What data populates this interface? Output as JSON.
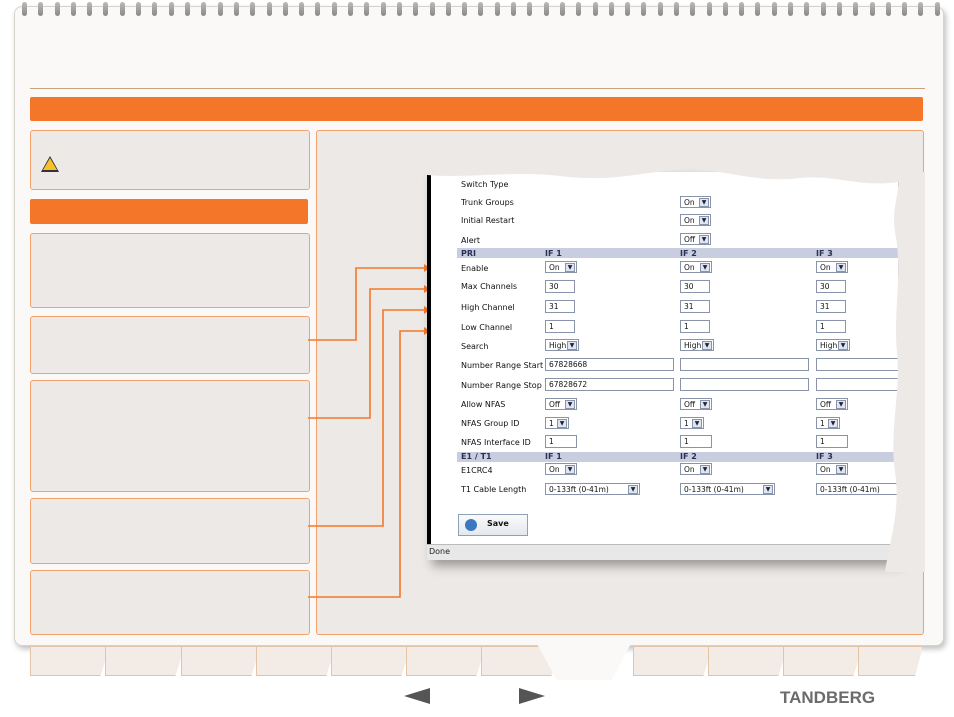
{
  "colors": {
    "accent": "#f47729",
    "panel_bg": "#ece9e6",
    "band": "#c8cde0"
  },
  "form": {
    "labels": {
      "switch_type": "Switch Type",
      "trunk_groups": "Trunk Groups",
      "initial_restart": "Initial Restart",
      "alert": "Alert",
      "pri": "PRI",
      "enable": "Enable",
      "max_channels": "Max Channels",
      "high_channel": "High Channel",
      "low_channel": "Low Channel",
      "search": "Search",
      "number_range_start": "Number Range Start",
      "number_range_stop": "Number Range Stop",
      "allow_nfas": "Allow NFAS",
      "nfas_group_id": "NFAS Group ID",
      "nfas_interface_id": "NFAS Interface ID",
      "e1_t1": "E1 / T1",
      "e1crc4": "E1CRC4",
      "t1_cable_length": "T1 Cable Length"
    },
    "if_headers": [
      "IF 1",
      "IF 2",
      "IF 3"
    ],
    "general": {
      "trunk_groups": "On",
      "initial_restart": "On",
      "alert": "Off"
    },
    "interfaces": [
      {
        "enable": "On",
        "max_channels": "30",
        "high_channel": "31",
        "low_channel": "1",
        "search": "High",
        "range_start": "67828668",
        "range_stop": "67828672",
        "allow_nfas": "Off",
        "nfas_group_id": "1",
        "nfas_interface_id": "1",
        "e1crc4": "On",
        "t1_cable_length": "0-133ft (0-41m)"
      },
      {
        "enable": "On",
        "max_channels": "30",
        "high_channel": "31",
        "low_channel": "1",
        "search": "High",
        "range_start": "",
        "range_stop": "",
        "allow_nfas": "Off",
        "nfas_group_id": "1",
        "nfas_interface_id": "1",
        "e1crc4": "On",
        "t1_cable_length": "0-133ft (0-41m)"
      },
      {
        "enable": "On",
        "max_channels": "30",
        "high_channel": "31",
        "low_channel": "1",
        "search": "High",
        "range_start": "",
        "range_stop": "",
        "allow_nfas": "Off",
        "nfas_group_id": "1",
        "nfas_interface_id": "1",
        "e1crc4": "On",
        "t1_cable_length": "0-133ft (0-41m)"
      }
    ],
    "save_label": "Save",
    "status": "Done"
  },
  "icons": [
    "warning-icon",
    "save-disk-icon",
    "dropdown-arrow-icon",
    "prev-arrow-icon",
    "next-arrow-icon"
  ],
  "brand": "TANDBERG"
}
